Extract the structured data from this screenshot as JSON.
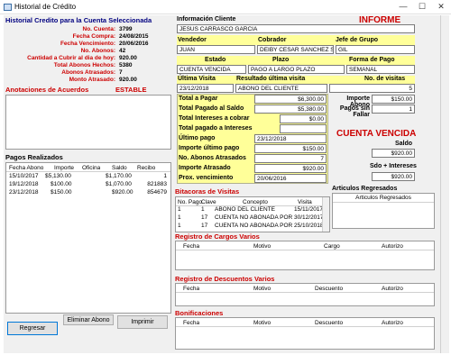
{
  "window": {
    "title": "Historial de Crédito",
    "minimize": "—",
    "maximize": "☐",
    "close": "✕"
  },
  "left": {
    "header": "Historial Credito para la Cuenta Seleccionada",
    "summary": [
      {
        "label": "No. Cuenta:",
        "value": "3799"
      },
      {
        "label": "Fecha Compra:",
        "value": "24/08/2015"
      },
      {
        "label": "Fecha Vencimiento:",
        "value": "20/06/2016"
      },
      {
        "label": "No. Abonos:",
        "value": "42"
      },
      {
        "label": "Cantidad a Cubrir al dia de hoy:",
        "value": "920.00"
      },
      {
        "label": "Total Abonos  Hechos:",
        "value": "5380"
      },
      {
        "label": "Abonos Atrasados:",
        "value": "7"
      },
      {
        "label": "Monto Atrasado:",
        "value": "920.00"
      }
    ],
    "anotaciones_label": "Anotaciones de Acuerdos",
    "status": "ESTABLE",
    "pagos_label": "Pagos Realizados",
    "pagos_cols": [
      "Fecha Abono",
      "Importe",
      "Oficina",
      "Saldo",
      "Recibo"
    ],
    "pagos_rows": [
      {
        "fecha": "15/10/2017",
        "importe": "$5,130.00",
        "oficina": "",
        "saldo": "$1,170.00",
        "recibo": "1"
      },
      {
        "fecha": "19/12/2018",
        "importe": "$100.00",
        "oficina": "",
        "saldo": "$1,070.00",
        "recibo": "821883"
      },
      {
        "fecha": "23/12/2018",
        "importe": "$150.00",
        "oficina": "",
        "saldo": "$920.00",
        "recibo": "854679"
      }
    ],
    "buttons": {
      "regresar": "Regresar",
      "eliminar": "Eliminar Abono",
      "imprimir": "Imprimir"
    }
  },
  "info": {
    "cliente_label": "Información Cliente",
    "report_title": "INFORME COBRANZA",
    "cliente": "JESUS CARRASCO GARCIA",
    "vendedor_label": "Vendedor",
    "cobrador_label": "Cobrador",
    "jefe_label": "Jefe de Grupo",
    "vendedor": "JUAN",
    "cobrador": "DEIBY CESAR SANCHEZ SEDA",
    "jefe": "GIL",
    "estado_label": "Estado",
    "plazo_label": "Plazo",
    "forma_label": "Forma de Pago",
    "estado": "CUENTA VENCIDA",
    "plazo": "PAGO A LARGO PLAZO",
    "forma": "SEMANAL",
    "ultima_label": "Última Visita",
    "resultado_label": "Resultado última visita",
    "novisitas_label": "No. de visitas",
    "ultima": "23/12/2018",
    "resultado": "ABONO DEL CLIENTE",
    "novisitas": "5"
  },
  "totals": [
    {
      "label": "Total a Pagar",
      "value": "$6,300.00"
    },
    {
      "label": "Total Pagado al Saldo",
      "value": "$5,380.00"
    },
    {
      "label": "Total Intereses a cobrar",
      "value": "$0.00"
    },
    {
      "label": "Total pagado a Intereses",
      "value": ""
    },
    {
      "label": "Último pago",
      "value": "23/12/2018"
    },
    {
      "label": "Importe último pago",
      "value": "$150.00"
    },
    {
      "label": "No. Abonos Atrasados",
      "value": "7"
    },
    {
      "label": "Importe Atrasado",
      "value": "$920.00"
    },
    {
      "label": "Prox. vencimiento",
      "value": "20/06/2016"
    }
  ],
  "side": {
    "importe_abono_label": "Importe Abono",
    "importe_abono": "$150.00",
    "pagos_sin_fallar_label": "Pagos sin Fallar",
    "pagos_sin_fallar": "1",
    "cuenta_vencida": "CUENTA VENCIDA",
    "saldo_label": "Saldo",
    "saldo": "$920.00",
    "sdo_int_label": "Sdo + Intereses",
    "sdo_int": "$920.00"
  },
  "bitacoras": {
    "title": "Bitacoras de Visitas",
    "cols": [
      "No. Pago",
      "Clave",
      "Concepto",
      "Visita"
    ],
    "rows": [
      {
        "nopago": "1",
        "clave": "1",
        "concepto": "ABONO DEL CLIENTE",
        "visita": "15/11/2017"
      },
      {
        "nopago": "1",
        "clave": "17",
        "concepto": "CUENTA NO ABONADA POR",
        "visita": "30/12/2017"
      },
      {
        "nopago": "1",
        "clave": "17",
        "concepto": "CUENTA NO ABONADA POR",
        "visita": "25/10/2018"
      }
    ]
  },
  "articulos": {
    "title": "Articulos Regresados",
    "col": "Articulos Regresados"
  },
  "cargos": {
    "title": "Registro de Cargos Varios",
    "cols": [
      "Fecha",
      "Motivo",
      "Cargo",
      "Autorizo"
    ]
  },
  "descuentos": {
    "title": "Registro de Descuentos Varios",
    "cols": [
      "Fecha",
      "Motivo",
      "Descuento",
      "Autorizo"
    ]
  },
  "bonificaciones": {
    "title": "Bonificaciones",
    "cols": [
      "Fecha",
      "Motivo",
      "Descuento",
      "Autorizo"
    ]
  }
}
